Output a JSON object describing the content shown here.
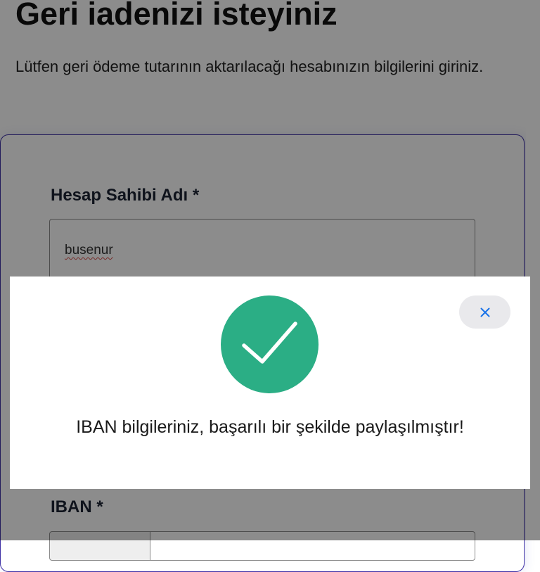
{
  "page": {
    "title": "Geri iadenizi isteyiniz",
    "subtitle": "Lütfen geri ödeme tutarının aktarılacağı hesabınızın bilgilerini giriniz."
  },
  "form": {
    "account_holder": {
      "label": "Hesap Sahibi Adı *",
      "value": "busenur"
    },
    "iban": {
      "label": "IBAN *"
    }
  },
  "modal": {
    "message": "IBAN bilgileriniz, başarılı bir şekilde paylaşılmıştır!",
    "close_icon": "close-icon",
    "status_icon": "check-icon"
  },
  "colors": {
    "success": "#2bae85",
    "card_border": "#3d2fa5",
    "close_icon": "#1a73e8"
  }
}
